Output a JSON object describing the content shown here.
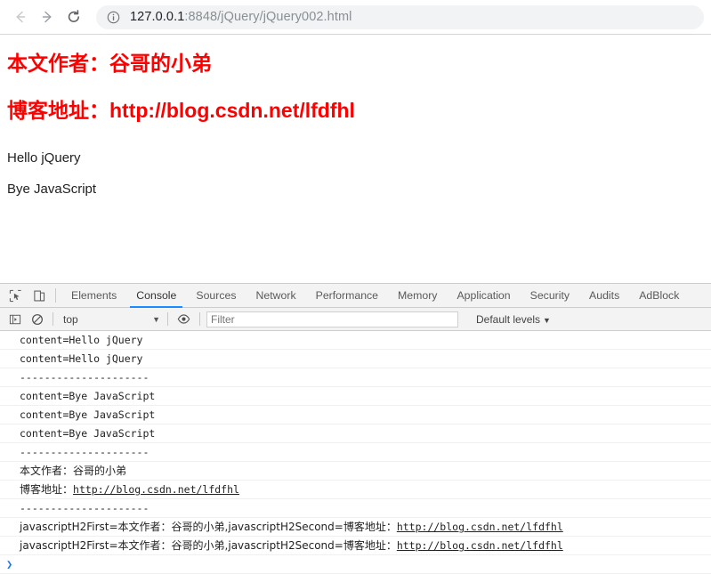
{
  "browser": {
    "back_label": "back-arrow",
    "forward_label": "forward-arrow",
    "reload_label": "reload",
    "url_host": "127.0.0.1",
    "url_rest": ":8848/jQuery/jQuery002.html",
    "url_full": "127.0.0.1:8848/jQuery/jQuery002.html",
    "site_info_icon": "info-circle-icon"
  },
  "page": {
    "heading1": "本文作者：谷哥的小弟",
    "heading2": "博客地址：http://blog.csdn.net/lfdfhl",
    "paragraph1": "Hello jQuery",
    "paragraph2": "Bye JavaScript",
    "heading_color": "#ff0000",
    "text_color": "#202124"
  },
  "devtools": {
    "inspect_icon": "inspect-element-icon",
    "device_icon": "device-toolbar-icon",
    "tabs": [
      {
        "label": "Elements",
        "active": false
      },
      {
        "label": "Console",
        "active": true
      },
      {
        "label": "Sources",
        "active": false
      },
      {
        "label": "Network",
        "active": false
      },
      {
        "label": "Performance",
        "active": false
      },
      {
        "label": "Memory",
        "active": false
      },
      {
        "label": "Application",
        "active": false
      },
      {
        "label": "Security",
        "active": false
      },
      {
        "label": "Audits",
        "active": false
      },
      {
        "label": "AdBlock",
        "active": false
      }
    ],
    "active_tab_underline_color": "#1a8cff",
    "filterbar": {
      "sidebar_icon": "console-sidebar-icon",
      "clear_icon": "clear-console-icon",
      "context_value": "top",
      "context_caret": "▼",
      "eye_icon": "live-expression-eye-icon",
      "filter_placeholder": "Filter",
      "filter_value": "",
      "levels_label": "Default levels",
      "levels_caret": "▼"
    },
    "console_rows": [
      {
        "text": "content=Hello jQuery",
        "cjk": false
      },
      {
        "text": "content=Hello jQuery",
        "cjk": false
      },
      {
        "text": "---------------------",
        "cjk": false
      },
      {
        "text": "content=Bye JavaScript",
        "cjk": false
      },
      {
        "text": "content=Bye JavaScript",
        "cjk": false
      },
      {
        "text": "content=Bye JavaScript",
        "cjk": false
      },
      {
        "text": "---------------------",
        "cjk": false
      },
      {
        "text": "本文作者：谷哥的小弟",
        "cjk": true
      },
      {
        "text": "博客地址：",
        "cjk": true,
        "link": "http://blog.csdn.net/lfdfhl"
      },
      {
        "text": "---------------------",
        "cjk": false
      },
      {
        "text": "javascriptH2First=本文作者：谷哥的小弟,javascriptH2Second=博客地址：",
        "cjk": true,
        "link": "http://blog.csdn.net/lfdfhl"
      },
      {
        "text": "javascriptH2First=本文作者：谷哥的小弟,javascriptH2Second=博客地址：",
        "cjk": true,
        "link": "http://blog.csdn.net/lfdfhl"
      }
    ],
    "prompt_chevron": "❯"
  }
}
